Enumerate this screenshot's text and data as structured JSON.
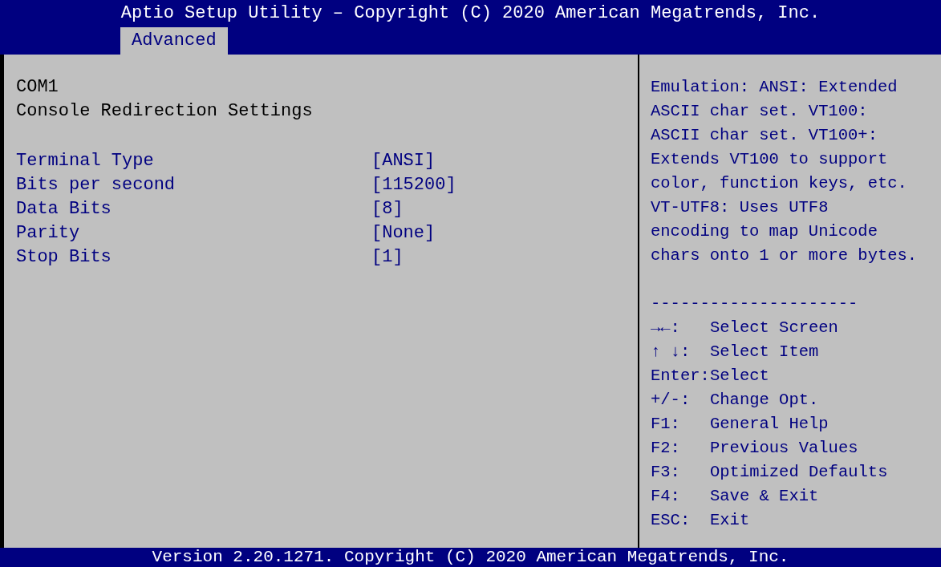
{
  "header": {
    "title": "Aptio Setup Utility – Copyright (C) 2020 American Megatrends, Inc.",
    "tabs": [
      {
        "label": "Advanced",
        "selected": true
      }
    ]
  },
  "main": {
    "heading": "COM1",
    "subheading": "Console Redirection Settings",
    "settings": [
      {
        "label": "Terminal Type",
        "value": "[ANSI]"
      },
      {
        "label": "Bits per second",
        "value": "[115200]"
      },
      {
        "label": "Data Bits",
        "value": "[8]"
      },
      {
        "label": "Parity",
        "value": "[None]"
      },
      {
        "label": "Stop Bits",
        "value": "[1]"
      }
    ]
  },
  "help": {
    "lines": [
      "Emulation: ANSI: Extended",
      "ASCII char set. VT100:",
      "ASCII char set. VT100+:",
      "Extends VT100 to support",
      "color, function keys, etc.",
      "VT-UTF8: Uses UTF8",
      "encoding to map Unicode",
      "chars onto 1 or more bytes."
    ],
    "separator": "---------------------",
    "keys": [
      {
        "key": "→←:",
        "action": "Select Screen"
      },
      {
        "key": "↑ ↓:",
        "action": "Select Item"
      },
      {
        "key": "Enter:",
        "action": "Select"
      },
      {
        "key": "+/-:",
        "action": "Change Opt."
      },
      {
        "key": "F1:",
        "action": "General Help"
      },
      {
        "key": "F2:",
        "action": "Previous Values"
      },
      {
        "key": "F3:",
        "action": "Optimized Defaults"
      },
      {
        "key": "F4:",
        "action": "Save & Exit"
      },
      {
        "key": "ESC:",
        "action": "Exit"
      }
    ]
  },
  "footer": {
    "text": "Version 2.20.1271. Copyright (C) 2020 American Megatrends, Inc."
  }
}
